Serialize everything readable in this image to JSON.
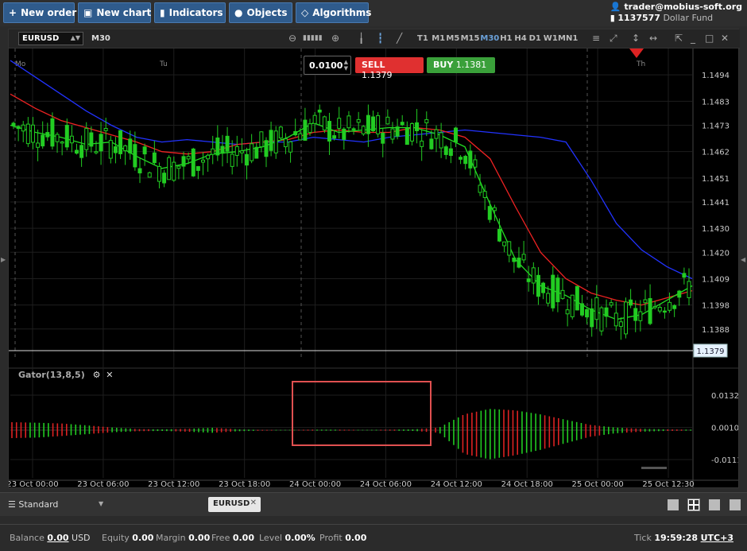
{
  "toolbar": {
    "new_order": "New order",
    "new_chart": "New chart",
    "indicators": "Indicators",
    "objects": "Objects",
    "algorithms": "Algorithms"
  },
  "account": {
    "email": "trader@mobius-soft.org",
    "number": "1137577",
    "fund": "Dollar Fund"
  },
  "chart_window": {
    "symbol": "EURUSD",
    "timeframe_label": "M30",
    "timeframes": [
      "T1",
      "M1",
      "M5",
      "M15",
      "M30",
      "H1",
      "H4",
      "D1",
      "W1",
      "MN1"
    ],
    "active_timeframe": "M30",
    "day_labels": [
      "Mo",
      "Tu",
      "Th"
    ],
    "order": {
      "volume": "0.0100",
      "sell_label": "SELL",
      "sell_price": "1.1379",
      "buy_label": "BUY",
      "buy_price": "1.1381"
    },
    "indicator_label": "Gator(13,8,5)"
  },
  "chart_data": [
    {
      "type": "candlestick",
      "symbol": "EURUSD",
      "timeframe": "M30",
      "y_ticks": [
        "1.1494",
        "1.1483",
        "1.1473",
        "1.1462",
        "1.1451",
        "1.1441",
        "1.1430",
        "1.1420",
        "1.1409",
        "1.1398",
        "1.1388"
      ],
      "ylim": [
        1.1375,
        1.1505
      ],
      "current_price": "1.1379",
      "series": [
        {
          "color": "#2233ff",
          "close_path": [
            1.15,
            1.1493,
            1.1486,
            1.1479,
            1.1473,
            1.1468,
            1.1466,
            1.1467,
            1.1466,
            1.1465,
            1.1466,
            1.1466,
            1.1468,
            1.1467,
            1.1466,
            1.1468,
            1.1469,
            1.147,
            1.1471,
            1.147,
            1.1469,
            1.1468,
            1.1466,
            1.145,
            1.1432,
            1.1421,
            1.1414,
            1.1409
          ]
        },
        {
          "color": "#ee2222",
          "close_path": [
            1.1486,
            1.148,
            1.1475,
            1.1472,
            1.1469,
            1.1466,
            1.1462,
            1.1461,
            1.1462,
            1.1465,
            1.1466,
            1.1467,
            1.147,
            1.1471,
            1.147,
            1.147,
            1.1472,
            1.1471,
            1.1468,
            1.1459,
            1.1439,
            1.142,
            1.1409,
            1.1403,
            1.14,
            1.1398,
            1.1401,
            1.1404
          ]
        },
        {
          "color": "#22dd22",
          "close_path": [
            1.1473,
            1.147,
            1.1468,
            1.1465,
            1.1466,
            1.146,
            1.1455,
            1.1457,
            1.1461,
            1.1462,
            1.1464,
            1.1468,
            1.1474,
            1.147,
            1.1471,
            1.1472,
            1.1472,
            1.1469,
            1.1464,
            1.144,
            1.1417,
            1.1406,
            1.1402,
            1.1396,
            1.1392,
            1.1394,
            1.14,
            1.1406
          ]
        }
      ]
    },
    {
      "type": "bar",
      "name": "Gator(13,8,5)",
      "y_ticks": [
        "0.0132",
        "0.0010",
        "-0.0111"
      ],
      "ylim": [
        -0.018,
        0.018
      ],
      "upper_values": [
        0.003,
        0.0028,
        0.0025,
        0.0018,
        0.001,
        0.0004,
        0.0003,
        0.0005,
        0.0009,
        0.0003,
        0.0001,
        0.0001,
        0.0002,
        0.0002,
        0.0001,
        0.0002,
        0.0003,
        0.001,
        0.006,
        0.008,
        0.0075,
        0.006,
        0.004,
        0.002,
        0.001,
        0.0005,
        0.0003,
        0.0002
      ],
      "lower_values": [
        -0.003,
        -0.0028,
        -0.0022,
        -0.0015,
        -0.0008,
        -0.0004,
        -0.0003,
        -0.0006,
        -0.001,
        -0.0004,
        -0.0002,
        -0.0001,
        -0.0002,
        -0.0002,
        -0.0001,
        -0.0002,
        -0.0003,
        -0.001,
        -0.009,
        -0.011,
        -0.0095,
        -0.0075,
        -0.005,
        -0.0025,
        -0.0012,
        -0.0006,
        -0.0003,
        -0.0002
      ]
    }
  ],
  "x_ticks": [
    "23 Oct 00:00",
    "23 Oct 06:00",
    "23 Oct 12:00",
    "23 Oct 18:00",
    "24 Oct 00:00",
    "24 Oct 06:00",
    "24 Oct 12:00",
    "24 Oct 18:00",
    "25 Oct 00:00",
    "25 Oct 12:30"
  ],
  "bottom": {
    "layout": "Standard",
    "chart_tab": "EURUSD"
  },
  "status": {
    "balance_label": "Balance",
    "balance": "0.00",
    "currency": "USD",
    "equity_label": "Equity",
    "equity": "0.00",
    "margin_label": "Margin",
    "margin": "0.00",
    "free_label": "Free",
    "free": "0.00",
    "level_label": "Level",
    "level": "0.00%",
    "profit_label": "Profit",
    "profit": "0.00",
    "tick_label": "Tick",
    "time": "19:59:28",
    "tz": "UTC+3"
  },
  "colors": {
    "bull": "#22cc22",
    "bear": "#dd2222",
    "sell": "#e03030",
    "buy": "#3aa03a",
    "highlight": "#e05050"
  }
}
